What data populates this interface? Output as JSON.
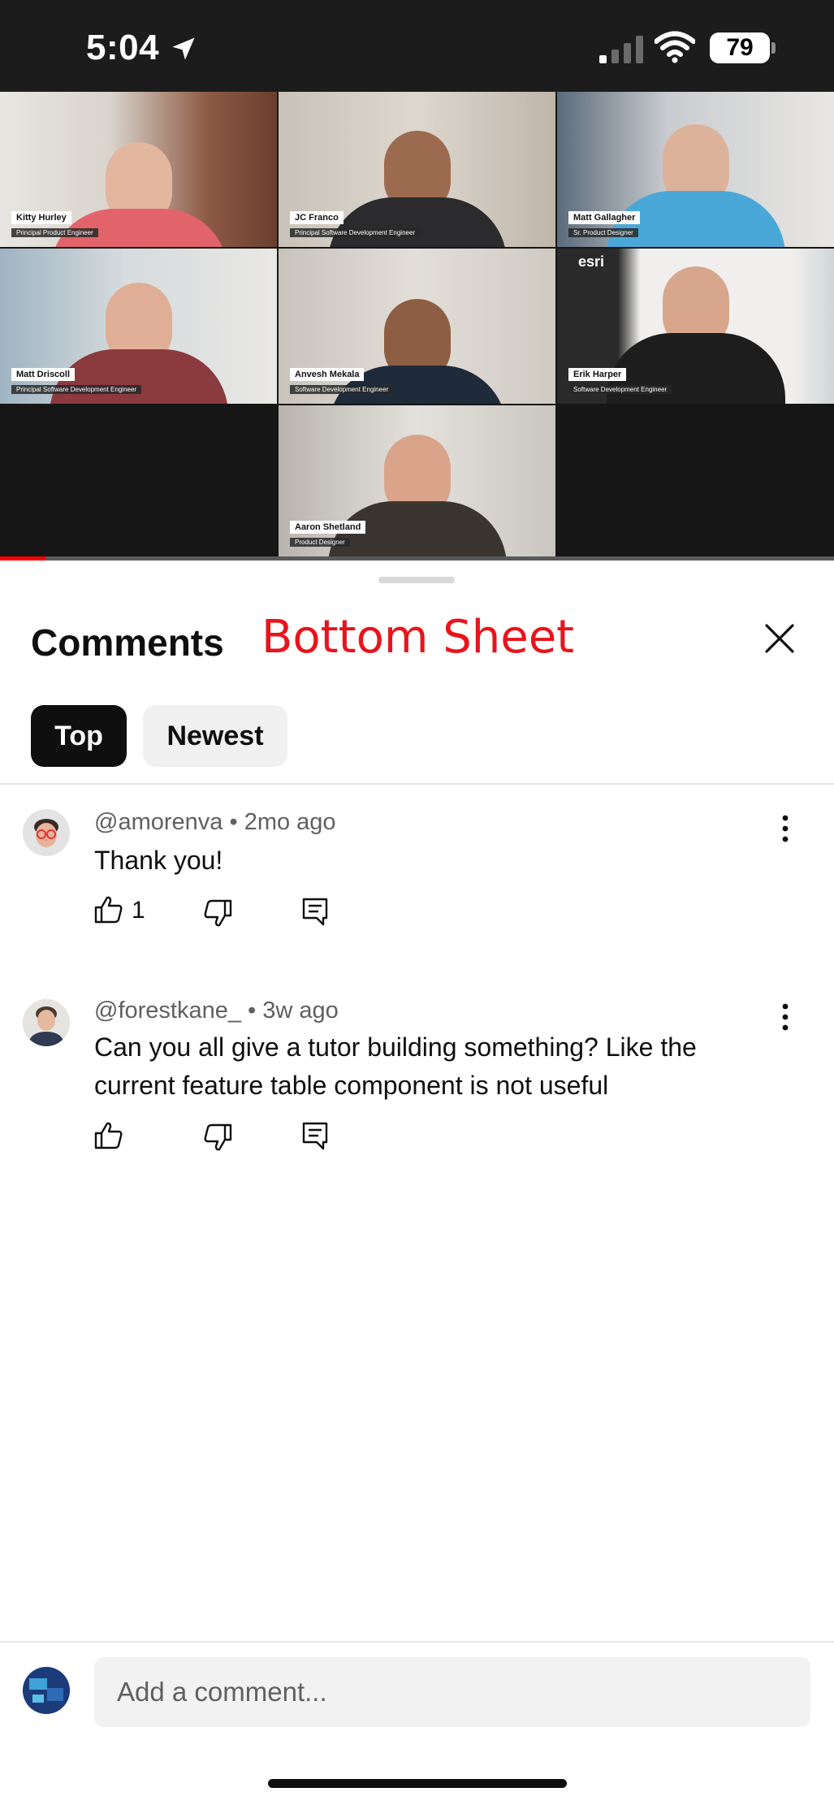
{
  "status_bar": {
    "time": "5:04",
    "battery": "79"
  },
  "video": {
    "participants": [
      {
        "name": "Kitty Hurley",
        "role": "Principal Product Engineer"
      },
      {
        "name": "JC Franco",
        "role": "Principal Software Development Engineer"
      },
      {
        "name": "Matt Gallagher",
        "role": "Sr. Product Designer"
      },
      {
        "name": "Matt Driscoll",
        "role": "Principal Software Development Engineer"
      },
      {
        "name": "Anvesh Mekala",
        "role": "Software Development Engineer"
      },
      {
        "name": "Erik Harper",
        "role": "Software Development Engineer"
      },
      {
        "name": "Aaron Shetland",
        "role": "Product Designer"
      }
    ],
    "wall_logo": "esri",
    "progress_fraction": 0.055
  },
  "sheet": {
    "title": "Comments",
    "annotation": "Bottom Sheet",
    "filters": [
      "Top",
      "Newest"
    ],
    "selected_filter": "Top"
  },
  "comments": [
    {
      "author": "@amorenva",
      "time": "2mo ago",
      "text": "Thank you!",
      "likes": "1"
    },
    {
      "author": "@forestkane_",
      "time": "3w ago",
      "text": "Can you all give a tutor building something? Like the current feature table component is not useful",
      "likes": ""
    }
  ],
  "composer": {
    "placeholder": "Add a comment..."
  },
  "colors": {
    "accent_red": "#ff0000",
    "annotation_red": "#e8141c",
    "chip_selected": "#0f0f0f",
    "chip_unselected": "#f0f0f0"
  }
}
